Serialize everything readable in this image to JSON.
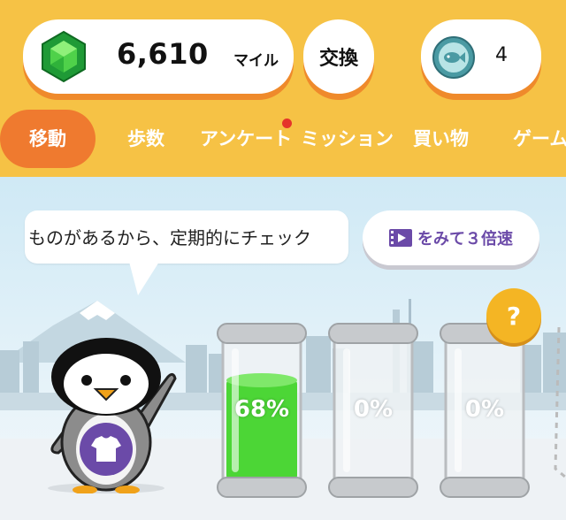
{
  "header": {
    "miles": {
      "icon": "emerald-gem-icon",
      "value": "6,610",
      "unit": "マイル"
    },
    "exchange_label": "交換",
    "tickets": {
      "icon": "fish-coin-icon",
      "count": "4"
    }
  },
  "tabs": [
    {
      "label": "移動",
      "active": true
    },
    {
      "label": "歩数",
      "active": false
    },
    {
      "label": "アンケート",
      "active": false,
      "notification": true
    },
    {
      "label": "ミッション",
      "active": false
    },
    {
      "label": "買い物",
      "active": false
    },
    {
      "label": "ゲーム",
      "active": false
    }
  ],
  "scene": {
    "speech_text": "ものがあるから、定期的にチェック",
    "watch_button": {
      "icon": "video-icon",
      "label": "をみて３倍速"
    },
    "jars": [
      {
        "label": "68%",
        "fill": 0.68
      },
      {
        "label": "0%",
        "fill": 0
      },
      {
        "label": "0%",
        "fill": 0
      }
    ],
    "help_label": "?",
    "character_icon": "tshirt-icon"
  },
  "colors": {
    "header_bg": "#f6c245",
    "active_tab": "#ef7a2f",
    "pill_shadow": "#ef8a2b",
    "jar_fill": "#4cd636",
    "accent_purple": "#6b4aa8"
  }
}
